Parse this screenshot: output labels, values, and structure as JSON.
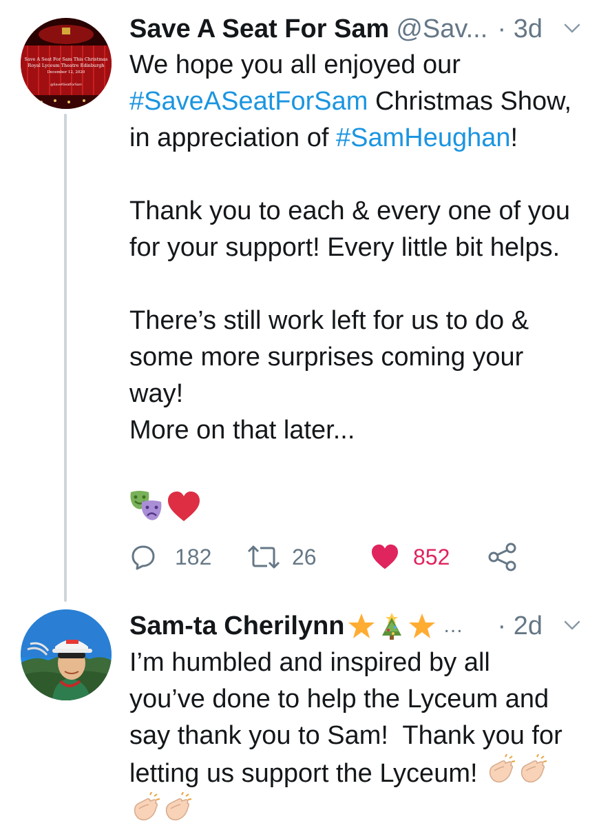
{
  "tweets": [
    {
      "author": "Save A Seat For Sam",
      "handle": "@Sav...",
      "time": "· 3d",
      "avatar_text": [
        "Save A Seat For Sam This Christmas",
        "Royal Lyceum Theatre Edinburgh",
        "December 12, 2020",
        "@SaveASeatForSam"
      ],
      "body": {
        "l1": "We hope you all enjoyed our",
        "hashtag1": "#SaveASeatForSam",
        "l2_rest": " Christmas Show,",
        "l3_start": "in appreciation of ",
        "hashtag2": "#SamHeughan",
        "l3_end": "!",
        "p2": "Thank you to each & every one of you\nfor your support! Every little bit helps.",
        "p3": "There’s still work left for us to do &\nsome more surprises coming your\nway!\nMore on that later..."
      },
      "emojis": [
        "performing-arts-icon",
        "red-heart-icon"
      ],
      "actions": {
        "replies": "182",
        "retweets": "26",
        "likes": "852"
      },
      "liked": true
    },
    {
      "author": "Sam-ta Cherilynn",
      "name_emojis": [
        "star-icon",
        "christmas-tree-icon",
        "star-icon"
      ],
      "overflow": "...",
      "time": "· 2d",
      "body": {
        "line1": "I’m humbled and inspired by all",
        "line2": "you’ve done to help the Lyceum and",
        "line3": "say thank you to Sam!  Thank you for",
        "line4": "letting us support the Lyceum! "
      },
      "emojis": [
        "clapping-hands-icon",
        "clapping-hands-icon",
        "clapping-hands-icon",
        "clapping-hands-icon"
      ]
    }
  ],
  "colors": {
    "link": "#1b95e0",
    "like": "#e0245e",
    "meta": "#657786",
    "text": "#14171a"
  }
}
